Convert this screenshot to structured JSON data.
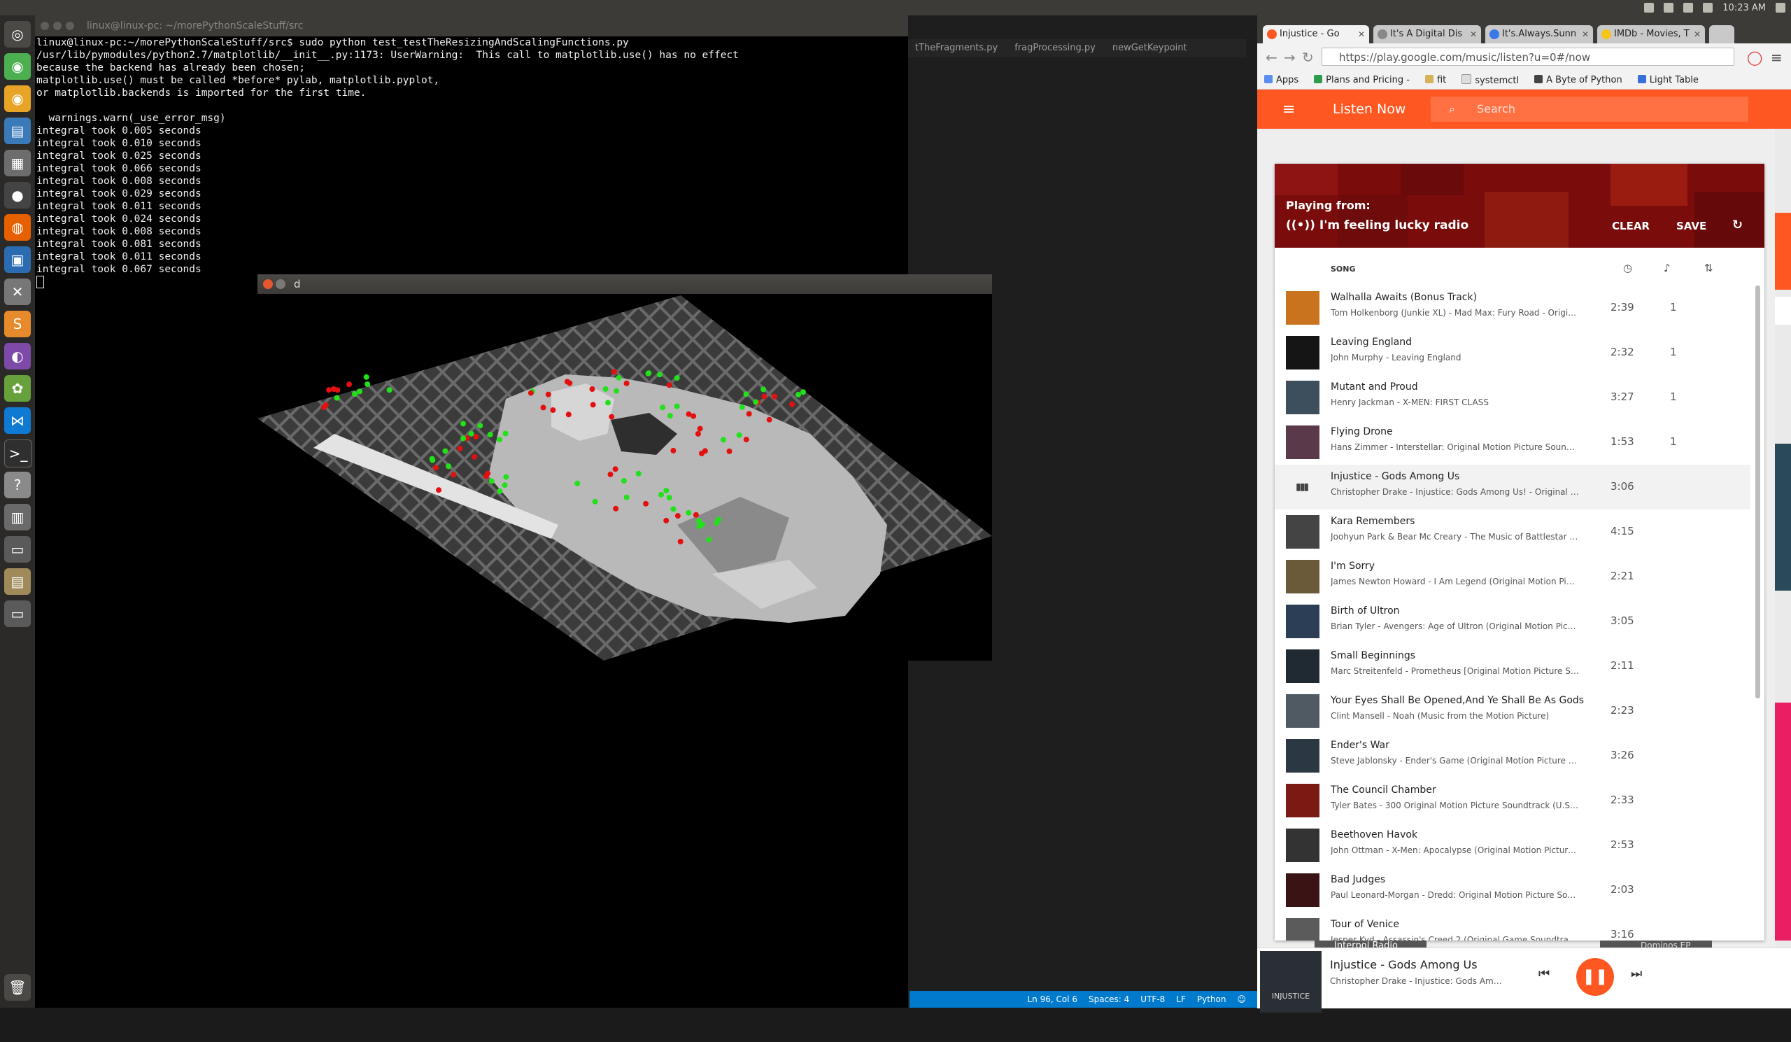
{
  "top_panel": {
    "time": "10:23 AM"
  },
  "terminal": {
    "title": "linux@linux-pc: ~/morePythonScaleStuff/src",
    "lines": [
      "linux@linux-pc:~/morePythonScaleStuff/src$ sudo python test_testTheResizingAndScalingFunctions.py",
      "/usr/lib/pymodules/python2.7/matplotlib/__init__.py:1173: UserWarning:  This call to matplotlib.use() has no effect",
      "because the backend has already been chosen;",
      "matplotlib.use() must be called *before* pylab, matplotlib.pyplot,",
      "or matplotlib.backends is imported for the first time.",
      "",
      "  warnings.warn(_use_error_msg)",
      "integral took 0.005 seconds",
      "integral took 0.010 seconds",
      "integral took 0.025 seconds",
      "integral took 0.066 seconds",
      "integral took 0.008 seconds",
      "integral took 0.029 seconds",
      "integral took 0.011 seconds",
      "integral took 0.024 seconds",
      "integral took 0.008 seconds",
      "integral took 0.081 seconds",
      "integral took 0.011 seconds",
      "integral took 0.067 seconds"
    ]
  },
  "image_window": {
    "title": "d"
  },
  "editor": {
    "tabs": [
      "tTheFragments.py",
      "fragProcessing.py",
      "newGetKeypoint"
    ],
    "status": {
      "position": "Ln 96, Col 6",
      "spaces": "Spaces: 4",
      "encoding": "UTF-8",
      "eol": "LF",
      "language": "Python"
    }
  },
  "chrome": {
    "tabs": [
      {
        "label": "Injustice - Go",
        "active": true,
        "fav_color": "#ff5722"
      },
      {
        "label": "It's A Digital Dis",
        "active": false,
        "fav_color": "#888888"
      },
      {
        "label": "It's.Always.Sunn",
        "active": false,
        "fav_color": "#3b78e7"
      },
      {
        "label": "IMDb - Movies, T",
        "active": false,
        "fav_color": "#f5c518"
      }
    ],
    "url": "https://play.google.com/music/listen?u=0#/now",
    "bookmarks": [
      "Apps",
      "Plans and Pricing -",
      "fit",
      "systemctl",
      "A Byte of Python",
      "Light Table"
    ]
  },
  "gpm": {
    "header_title": "Listen Now",
    "search_placeholder": "Search",
    "queue": {
      "playing_from_label": "Playing from:",
      "radio_name": "I'm feeling lucky radio",
      "clear_label": "CLEAR",
      "save_label": "SAVE",
      "song_header": "SONG"
    },
    "songs": [
      {
        "title": "Walhalla Awaits (Bonus Track)",
        "artist": "Tom Holkenborg (Junkie XL) - Mad Max: Fury Road - Original ...",
        "duration": "2:39",
        "plays": "1",
        "art": "#c9731f"
      },
      {
        "title": "Leaving England",
        "artist": "John Murphy - Leaving England",
        "duration": "2:32",
        "plays": "1",
        "art": "#151515"
      },
      {
        "title": "Mutant and Proud",
        "artist": "Henry Jackman - X-MEN: FIRST CLASS",
        "duration": "3:27",
        "plays": "1",
        "art": "#3d4f5c"
      },
      {
        "title": "Flying Drone",
        "artist": "Hans Zimmer - Interstellar: Original Motion Picture Soundtrac...",
        "duration": "1:53",
        "plays": "1",
        "art": "#5a3a4a"
      },
      {
        "title": "Injustice - Gods Among Us",
        "artist": "Christopher Drake - Injustice: Gods Among Us! - Original Vide...",
        "duration": "3:06",
        "plays": "",
        "art": ""
      },
      {
        "title": "Kara Remembers",
        "artist": "Joohyun Park & Bear Mc Creary - The Music of Battlestar Gal...",
        "duration": "4:15",
        "plays": "",
        "art": "#444444"
      },
      {
        "title": "I'm Sorry",
        "artist": "James Newton Howard - I Am Legend (Original Motion Pictur...",
        "duration": "2:21",
        "plays": "",
        "art": "#6b5a3a"
      },
      {
        "title": "Birth of Ultron",
        "artist": "Brian Tyler - Avengers: Age of Ultron (Original Motion Picture ...",
        "duration": "3:05",
        "plays": "",
        "art": "#2c3e55"
      },
      {
        "title": "Small Beginnings",
        "artist": "Marc Streitenfeld - Prometheus [Original Motion Picture Soun...",
        "duration": "2:11",
        "plays": "",
        "art": "#1f2a33"
      },
      {
        "title": "Your Eyes Shall Be Opened,And Ye Shall Be As Gods",
        "artist": "Clint Mansell - Noah (Music from the Motion Picture)",
        "duration": "2:23",
        "plays": "",
        "art": "#4f5a63"
      },
      {
        "title": "Ender's War",
        "artist": "Steve Jablonsky - Ender's Game (Original Motion Picture Sco...",
        "duration": "3:26",
        "plays": "",
        "art": "#2b3742"
      },
      {
        "title": "The Council Chamber",
        "artist": "Tyler Bates - 300 Original Motion Picture Soundtrack (U.S. Ve...",
        "duration": "2:33",
        "plays": "",
        "art": "#7a1a12"
      },
      {
        "title": "Beethoven Havok",
        "artist": "John Ottman - X-Men: Apocalypse (Original Motion Picture S...",
        "duration": "2:53",
        "plays": "",
        "art": "#333333"
      },
      {
        "title": "Bad Judges",
        "artist": "Paul Leonard-Morgan - Dredd: Original Motion Picture Soundt...",
        "duration": "2:03",
        "plays": "",
        "art": "#3a1414"
      },
      {
        "title": "Tour of Venice",
        "artist": "Jesper Kyd - Assassin's Creed 2 (Original Game Soundtrack)",
        "duration": "3:16",
        "plays": "",
        "art": "#5b5b5b"
      }
    ],
    "under_queue": {
      "left": "Interpol Radio",
      "right": "Dominos EP"
    },
    "player": {
      "title": "Injustice - Gods Among Us",
      "artist": "Christopher Drake - Injustice: Gods Among U...",
      "art_text": "INJUSTICE"
    }
  }
}
